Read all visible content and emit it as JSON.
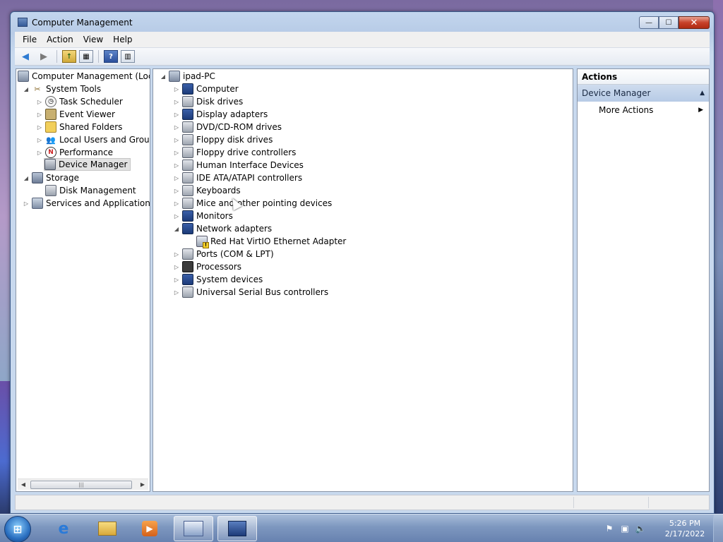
{
  "window": {
    "title": "Computer Management",
    "minimize": "—",
    "maximize": "☐",
    "close": "✕"
  },
  "menu": [
    "File",
    "Action",
    "View",
    "Help"
  ],
  "left_tree": {
    "root": "Computer Management (Local",
    "system_tools": "System Tools",
    "task_scheduler": "Task Scheduler",
    "event_viewer": "Event Viewer",
    "shared_folders": "Shared Folders",
    "local_users": "Local Users and Groups",
    "performance": "Performance",
    "device_manager": "Device Manager",
    "storage": "Storage",
    "disk_management": "Disk Management",
    "services_apps": "Services and Applications"
  },
  "device_tree": {
    "root": "ipad-PC",
    "categories": [
      "Computer",
      "Disk drives",
      "Display adapters",
      "DVD/CD-ROM drives",
      "Floppy disk drives",
      "Floppy drive controllers",
      "Human Interface Devices",
      "IDE ATA/ATAPI controllers",
      "Keyboards",
      "Mice and other pointing devices",
      "Monitors",
      "Network adapters",
      "Red Hat VirtIO Ethernet Adapter",
      "Ports (COM & LPT)",
      "Processors",
      "System devices",
      "Universal Serial Bus controllers"
    ]
  },
  "actions": {
    "header": "Actions",
    "section": "Device Manager",
    "more_actions": "More Actions"
  },
  "taskbar": {
    "time": "5:26 PM",
    "date": "2/17/2022"
  },
  "icons": {
    "back": "back-arrow-icon",
    "forward": "forward-arrow-icon",
    "help": "help-icon"
  }
}
